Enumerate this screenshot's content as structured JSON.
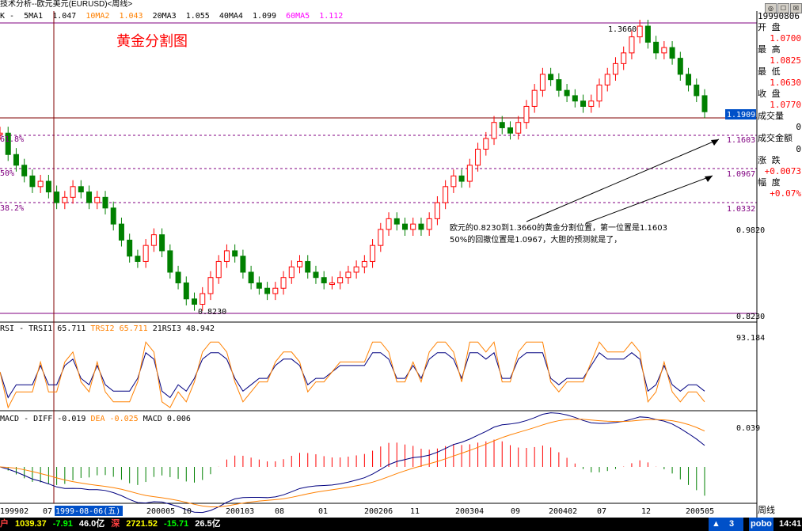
{
  "window": {
    "title": "技术分析--欧元美元(EURUSD)<周线>",
    "buttons": [
      "◎",
      "☐",
      "☒"
    ]
  },
  "ma_legend": {
    "prefix": "K - ",
    "items": [
      {
        "label": "5MA1",
        "value": "1.047",
        "color": "#000000"
      },
      {
        "label": "10MA2",
        "value": "1.043",
        "color": "#ff8000"
      },
      {
        "label": "20MA3",
        "value": "1.055",
        "color": "#000000"
      },
      {
        "label": "40MA4",
        "value": "1.099",
        "color": "#000000"
      },
      {
        "label": "60MA5",
        "value": "1.112",
        "color": "#ff00ff"
      }
    ]
  },
  "info_panel": {
    "date": "19990806",
    "rows": [
      {
        "label": "开  盘",
        "value": "1.0700",
        "color": "#ff0000"
      },
      {
        "label": "最  高",
        "value": "1.0825",
        "color": "#ff0000"
      },
      {
        "label": "最  低",
        "value": "1.0630",
        "color": "#ff0000"
      },
      {
        "label": "收  盘",
        "value": "1.0770",
        "color": "#ff0000"
      },
      {
        "label": "成交量",
        "value": "0",
        "color": "#000000"
      },
      {
        "label": "成交金额",
        "value": "0",
        "color": "#000000"
      },
      {
        "label": "涨  跌",
        "value": "+0.0073",
        "color": "#ff0000"
      },
      {
        "label": "幅  度",
        "value": "+0.07%",
        "color": "#ff0000"
      }
    ]
  },
  "chart_data": {
    "type": "candlestick",
    "title": "黄金分割图",
    "price_axis": {
      "labels": [
        "1.1909",
        "1.1603",
        "1.0967",
        "1.0332",
        "0.9820",
        "0.8230"
      ]
    },
    "fib_labels": [
      "61.8%",
      "50%",
      "38.2%"
    ],
    "high_label": "1.3660",
    "low_label": "0.8230",
    "annotation": {
      "line1": "欧元的0.8230到1.3660的黄金分割位置，第一位置是1.1603",
      "line2": "50%的回撤位置是1.0967，大胆的预测就是了，"
    },
    "rsi": {
      "prefix": "RSI - ",
      "items": [
        {
          "label": "TRSI1",
          "value": "65.711",
          "color": "#000000"
        },
        {
          "label": "TRSI2",
          "value": "65.711",
          "color": "#ff8000"
        },
        {
          "label": "21RSI3",
          "value": "48.942",
          "color": "#000000"
        }
      ],
      "axis_label": "93.184"
    },
    "macd": {
      "prefix": "MACD - ",
      "items": [
        {
          "label": "DIFF",
          "value": "-0.019",
          "color": "#000000"
        },
        {
          "label": "DEA",
          "value": "-0.025",
          "color": "#ff8000"
        },
        {
          "label": "MACD",
          "value": "0.006",
          "color": "#000000"
        }
      ],
      "axis_label": "0.039"
    },
    "x_axis": {
      "labels": [
        "199902",
        "07",
        "1999-08-06(五)",
        "200005",
        "10",
        "200103",
        "08",
        "01",
        "200206",
        "11",
        "200304",
        "09",
        "200402",
        "07",
        "12",
        "200505"
      ],
      "period": "周线"
    },
    "close_series": [
      1.16,
      1.12,
      1.1,
      1.08,
      1.06,
      1.07,
      1.05,
      1.03,
      1.04,
      1.06,
      1.05,
      1.03,
      1.04,
      1.02,
      0.99,
      0.96,
      0.93,
      0.92,
      0.95,
      0.97,
      0.94,
      0.9,
      0.88,
      0.85,
      0.84,
      0.86,
      0.89,
      0.92,
      0.94,
      0.93,
      0.9,
      0.88,
      0.87,
      0.86,
      0.87,
      0.89,
      0.91,
      0.92,
      0.9,
      0.89,
      0.88,
      0.88,
      0.89,
      0.9,
      0.91,
      0.92,
      0.95,
      0.98,
      1.0,
      0.99,
      0.98,
      0.99,
      0.98,
      1.0,
      1.03,
      1.06,
      1.08,
      1.07,
      1.1,
      1.13,
      1.15,
      1.18,
      1.17,
      1.16,
      1.18,
      1.21,
      1.24,
      1.27,
      1.26,
      1.24,
      1.23,
      1.22,
      1.21,
      1.22,
      1.25,
      1.27,
      1.29,
      1.31,
      1.34,
      1.36,
      1.33,
      1.31,
      1.32,
      1.3,
      1.27,
      1.25,
      1.23,
      1.2
    ]
  },
  "bottom_bar": {
    "items": [
      {
        "text": "户",
        "color": "#ff4040"
      },
      {
        "text": "1039.37",
        "color": "#ffff00"
      },
      {
        "text": "-7.91",
        "color": "#00ff00"
      },
      {
        "text": "46.0亿",
        "color": "#ffffff"
      },
      {
        "text": "深",
        "color": "#ff4040"
      },
      {
        "text": "2721.52",
        "color": "#ffff00"
      },
      {
        "text": "-15.71",
        "color": "#00ff00"
      },
      {
        "text": "26.5亿",
        "color": "#ffffff"
      }
    ],
    "alert_count": "3",
    "brand": "pobo",
    "clock": "14:41"
  }
}
